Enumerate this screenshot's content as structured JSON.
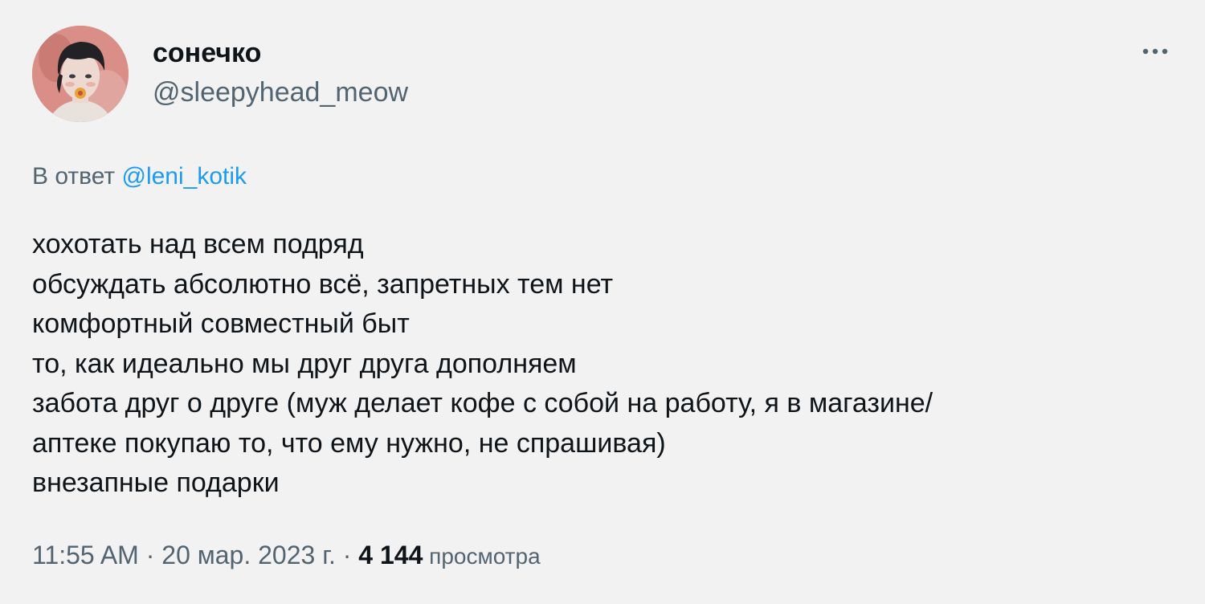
{
  "author": {
    "display_name": "сонечко",
    "handle": "@sleepyhead_meow",
    "avatar_icon": "avatar-illustration"
  },
  "more_icon": "more-dots-icon",
  "reply": {
    "prefix": "В ответ ",
    "mention": "@leni_kotik"
  },
  "text_lines": [
    "хохотать над всем подряд",
    "обсуждать абсолютно всё, запретных тем нет",
    "комфортный совместный быт",
    "то, как идеально мы друг друга дополняем",
    "забота друг о друге (муж делает кофе с собой на работу, я в магазине/",
    "аптеке покупаю то, что ему нужно, не спрашивая)",
    "внезапные подарки"
  ],
  "meta": {
    "time": "11:55 AM",
    "sep1": " · ",
    "date": "20 мар. 2023 г.",
    "sep2": " · ",
    "views_count": "4 144",
    "views_label": " просмотра"
  },
  "colors": {
    "background": "#f2f2f2",
    "text": "#0f1419",
    "secondary": "#536471",
    "link": "#1d9bf0"
  }
}
